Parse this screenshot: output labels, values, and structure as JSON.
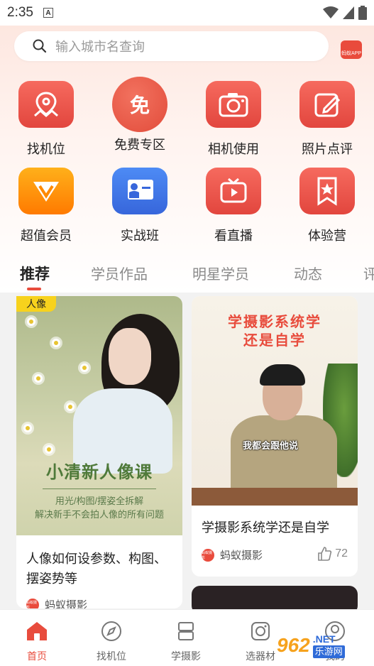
{
  "status_bar": {
    "time": "2:35",
    "indicator": "A"
  },
  "search": {
    "placeholder": "输入城市名查询"
  },
  "brand": {
    "logo_text": "蚂蚁APP"
  },
  "grid": [
    {
      "label": "找机位",
      "icon": "map-pin-icon"
    },
    {
      "label": "免费专区",
      "icon": "free-badge-icon",
      "badge_text": "免"
    },
    {
      "label": "相机使用",
      "icon": "camera-icon"
    },
    {
      "label": "照片点评",
      "icon": "edit-note-icon"
    },
    {
      "label": "超值会员",
      "icon": "vip-diamond-icon"
    },
    {
      "label": "实战班",
      "icon": "class-board-icon"
    },
    {
      "label": "看直播",
      "icon": "live-tv-icon"
    },
    {
      "label": "体验营",
      "icon": "bookmark-star-icon"
    }
  ],
  "tabs": [
    "推荐",
    "学员作品",
    "明星学员",
    "动态",
    "评"
  ],
  "active_tab": 0,
  "feed": {
    "left": {
      "tag": "人像",
      "cover_title": "小清新人像课",
      "cover_sub1": "用光/构图/摆姿全拆解",
      "cover_sub2": "解决新手不会拍人像的所有问题",
      "title": "人像如何设参数、构图、摆姿势等",
      "author": "蚂蚁摄影",
      "author_logo": "蚂蚁摄影"
    },
    "right": {
      "cover_title_line1": "学摄影系统学",
      "cover_title_line2": "还是自学",
      "caption": "我都会跟他说",
      "title": "学摄影系统学还是自学",
      "author": "蚂蚁摄影",
      "author_logo": "蚂蚁摄影",
      "likes": "72"
    }
  },
  "bottom_nav": [
    {
      "label": "首页",
      "icon": "home-icon",
      "active": true
    },
    {
      "label": "找机位",
      "icon": "compass-icon",
      "active": false
    },
    {
      "label": "学摄影",
      "icon": "book-stack-icon",
      "active": false
    },
    {
      "label": "选器材",
      "icon": "camera-outline-icon",
      "active": false
    },
    {
      "label": "我的",
      "icon": "profile-icon",
      "active": false
    }
  ],
  "watermark": {
    "number": "962",
    "net": ".NET",
    "cn": "乐游网"
  },
  "colors": {
    "accent": "#e84c3d",
    "orange": "#ff8a00",
    "blue": "#3766db"
  }
}
